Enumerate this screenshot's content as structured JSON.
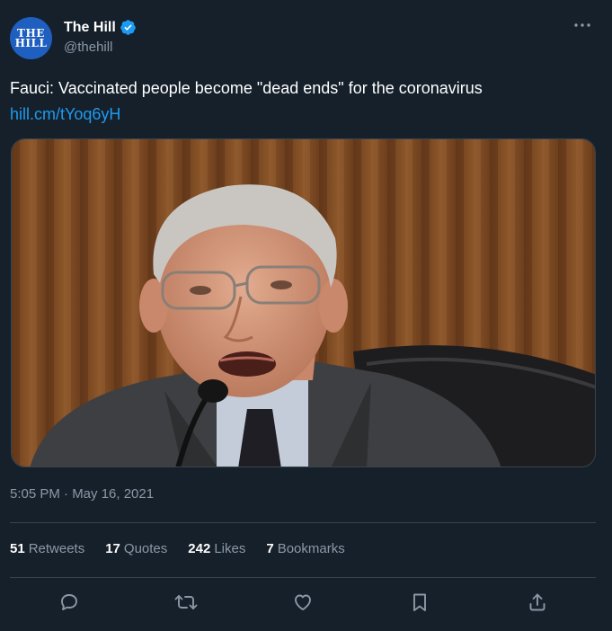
{
  "account": {
    "display_name": "The Hill",
    "handle": "@thehill",
    "avatar_logo_text": "THE HILL",
    "verified": true
  },
  "tweet": {
    "text": "Fauci: Vaccinated people become \"dead ends\" for the coronavirus",
    "link": "hill.cm/tYoq6yH",
    "timestamp": "5:05 PM · May 16, 2021"
  },
  "stats": [
    {
      "count": "51",
      "label": "Retweets"
    },
    {
      "count": "17",
      "label": "Quotes"
    },
    {
      "count": "242",
      "label": "Likes"
    },
    {
      "count": "7",
      "label": "Bookmarks"
    }
  ],
  "icons": {
    "more": "more-icon",
    "reply": "reply-icon",
    "retweet": "retweet-icon",
    "like": "like-icon",
    "bookmark": "bookmark-icon",
    "share": "share-icon"
  },
  "colors": {
    "background": "#15202b",
    "accent": "#1d9bf0",
    "secondary_text": "#8b98a5",
    "divider": "#38444d"
  }
}
